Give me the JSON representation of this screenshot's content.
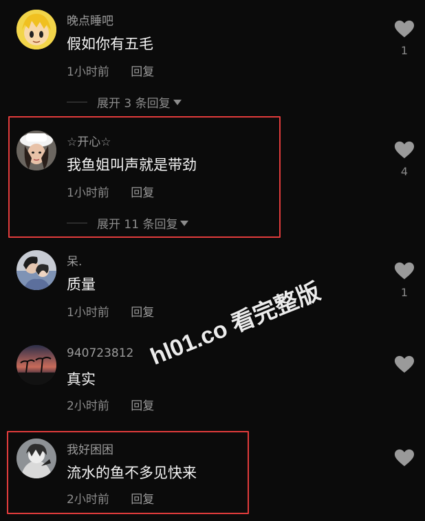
{
  "comments": [
    {
      "username": "晚点睡吧",
      "text": "假如你有五毛",
      "time": "1小时前",
      "reply": "回复",
      "expand": "展开 3 条回复",
      "likes": "1",
      "avatar": "cartoon-blonde-avatar"
    },
    {
      "username": "☆开心☆",
      "text": "我鱼姐叫声就是带劲",
      "time": "1小时前",
      "reply": "回复",
      "expand": "展开 11 条回复",
      "likes": "4",
      "avatar": "girl-with-hat-avatar"
    },
    {
      "username": "呆.",
      "text": "质量",
      "time": "1小时前",
      "reply": "回复",
      "likes": "1",
      "avatar": "couple-photo-avatar"
    },
    {
      "username": "940723812",
      "text": "真实",
      "time": "2小时前",
      "reply": "回复",
      "likes": "",
      "avatar": "sunset-palms-avatar"
    },
    {
      "username": "我好困困",
      "text": "流水的鱼不多见快来",
      "time": "2小时前",
      "reply": "回复",
      "likes": "",
      "avatar": "anime-character-avatar"
    }
  ],
  "watermark": "hl01.co 看完整版",
  "colors": {
    "background": "#0b0b0b",
    "highlight_border": "#e23c3c",
    "username": "#9b9b9b",
    "text": "#f4f4f4",
    "meta": "#8c8c8c",
    "heart": "#9a9a9a"
  }
}
